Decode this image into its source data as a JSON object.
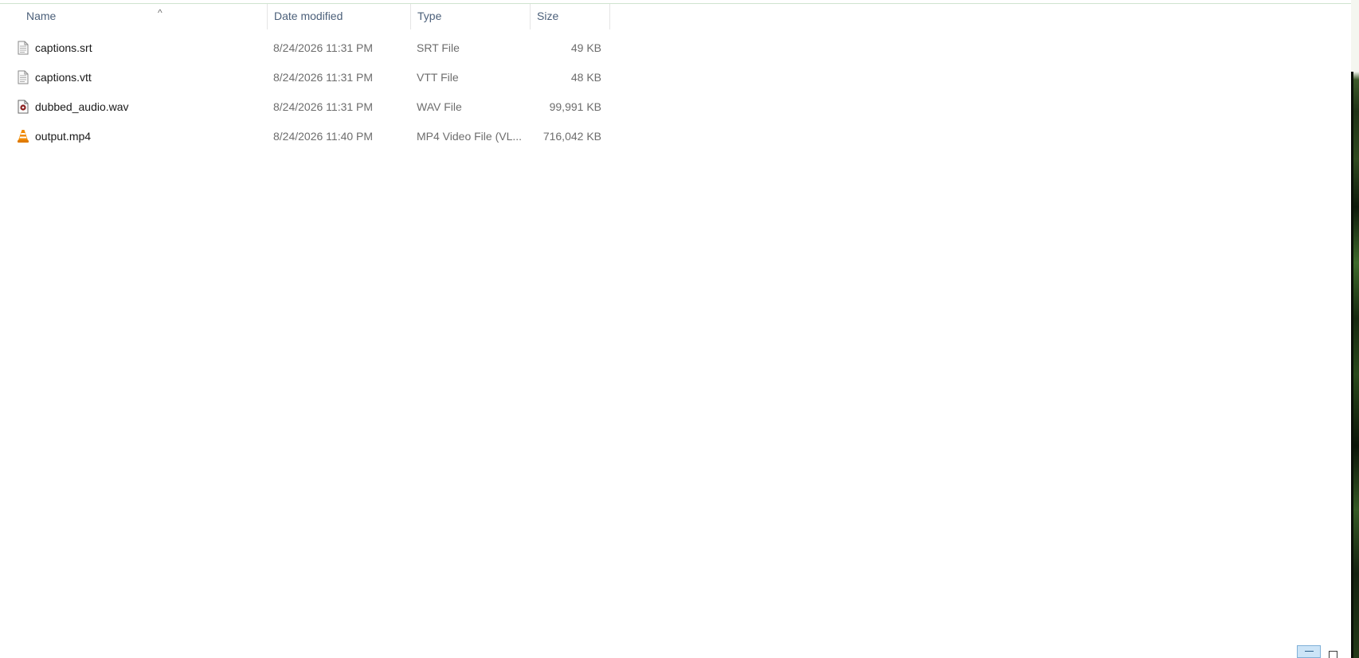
{
  "header": {
    "sort_indicator": "^",
    "columns": {
      "name": "Name",
      "date": "Date modified",
      "type": "Type",
      "size": "Size"
    }
  },
  "files": [
    {
      "name": "captions.srt",
      "date": "8/24/2026 11:31 PM",
      "type": "SRT File",
      "size": "49 KB",
      "icon": "text-document-icon"
    },
    {
      "name": "captions.vtt",
      "date": "8/24/2026 11:31 PM",
      "type": "VTT File",
      "size": "48 KB",
      "icon": "text-document-icon"
    },
    {
      "name": "dubbed_audio.wav",
      "date": "8/24/2026 11:31 PM",
      "type": "WAV File",
      "size": "99,991 KB",
      "icon": "audio-file-icon"
    },
    {
      "name": "output.mp4",
      "date": "8/24/2026 11:40 PM",
      "type": "MP4 Video File (VL...",
      "size": "716,042 KB",
      "icon": "vlc-cone-icon"
    }
  ],
  "view_buttons": {
    "details": "details-view-icon",
    "tiles": "large-icons-view-icon",
    "active": "details"
  },
  "colors": {
    "header_text": "#4c607a",
    "name_text": "#1a1a1a",
    "meta_text": "#6d6d6d",
    "vlc_orange": "#f08a00",
    "selected_view_bg": "#cce4f7"
  }
}
